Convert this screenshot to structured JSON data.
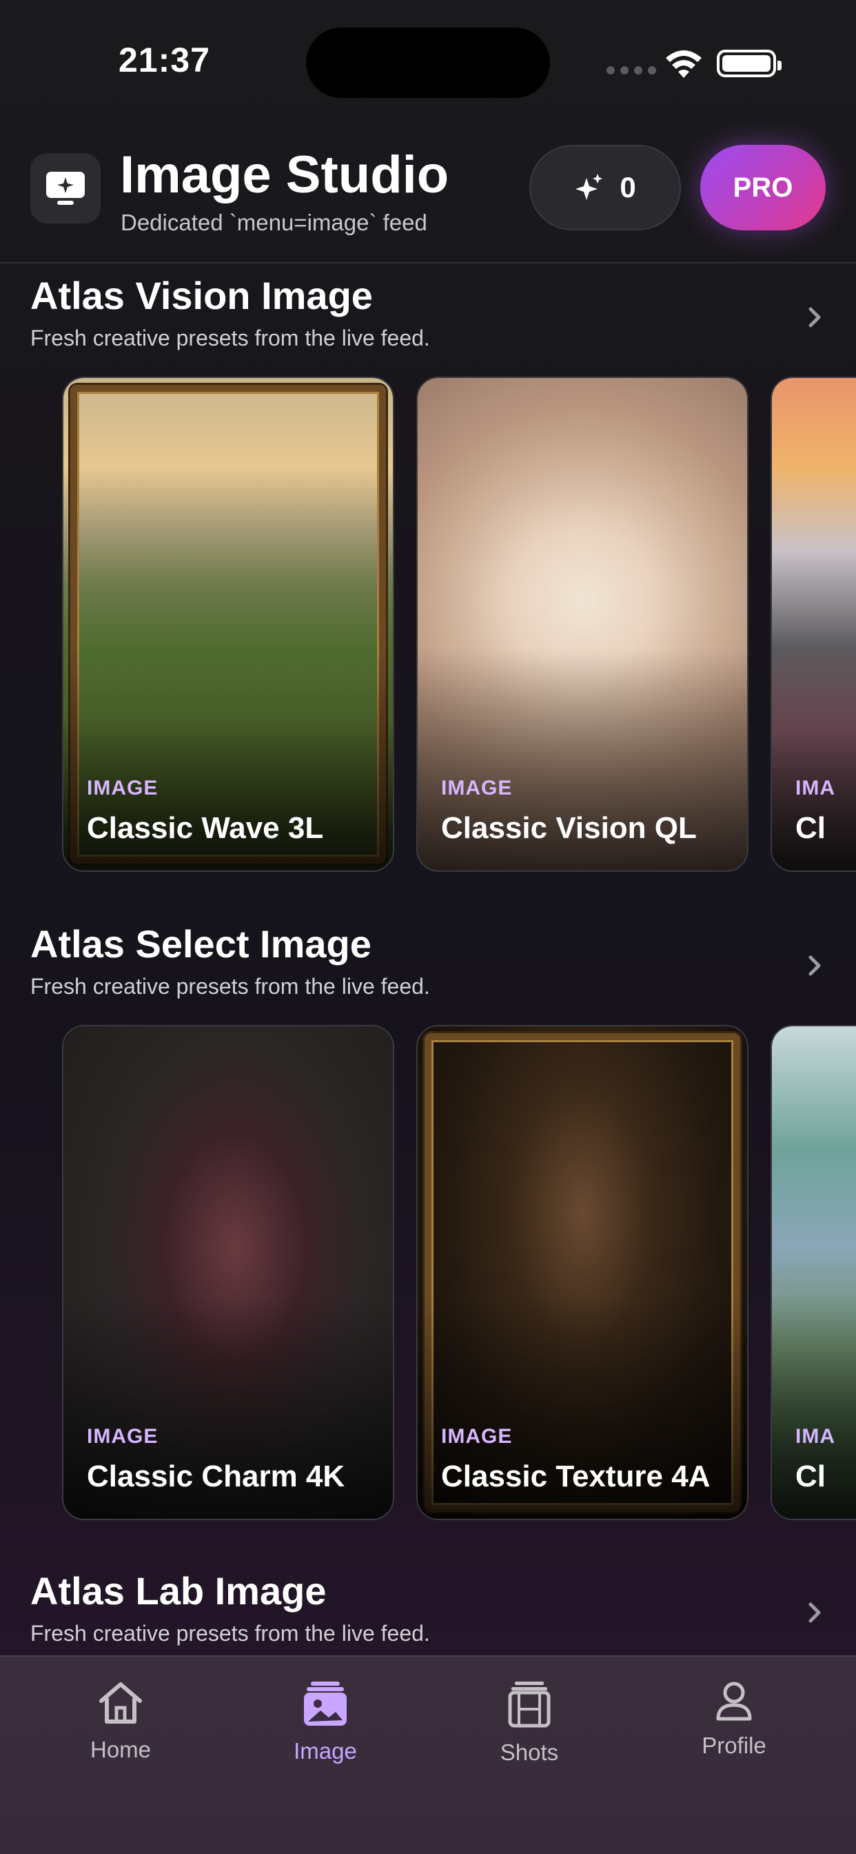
{
  "status_bar": {
    "time": "21:37"
  },
  "header": {
    "title": "Image Studio",
    "subtitle": "Dedicated `menu=image` feed",
    "credits": "0",
    "pro_label": "PRO"
  },
  "sections": [
    {
      "title": "Atlas Vision Image",
      "subtitle": "Fresh creative presets from the live feed.",
      "cards": [
        {
          "kind": "IMAGE",
          "title": "Classic Wave 3L"
        },
        {
          "kind": "IMAGE",
          "title": "Classic Vision QL"
        },
        {
          "kind": "IMA",
          "title": "Cl"
        }
      ]
    },
    {
      "title": "Atlas Select Image",
      "subtitle": "Fresh creative presets from the live feed.",
      "cards": [
        {
          "kind": "IMAGE",
          "title": "Classic Charm 4K"
        },
        {
          "kind": "IMAGE",
          "title": "Classic Texture 4A"
        },
        {
          "kind": "IMA",
          "title": "Cl"
        }
      ]
    },
    {
      "title": "Atlas Lab Image",
      "subtitle": "Fresh creative presets from the live feed."
    }
  ],
  "tabbar": {
    "items": [
      {
        "label": "Home",
        "icon": "home-icon"
      },
      {
        "label": "Image",
        "icon": "image-icon"
      },
      {
        "label": "Shots",
        "icon": "film-icon"
      },
      {
        "label": "Profile",
        "icon": "person-icon"
      }
    ],
    "active": "Image"
  },
  "colors": {
    "accent": "#c9a6ff",
    "pro_gradient_start": "#9b4cf0",
    "pro_gradient_end": "#e23a8c"
  }
}
